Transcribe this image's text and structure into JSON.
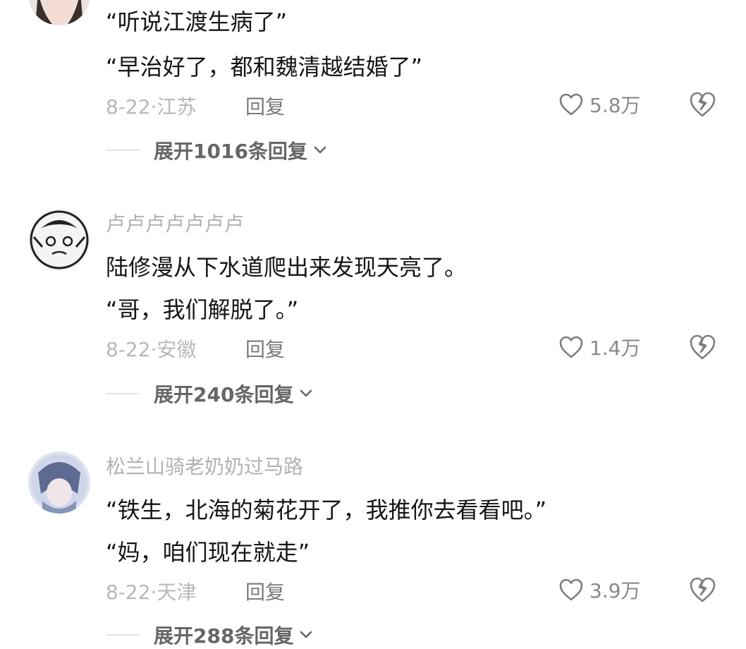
{
  "comments": [
    {
      "username": "",
      "lines": [
        "“听说江渡生病了”",
        "“早治好了，都和魏清越结婚了”"
      ],
      "date_location": "8-22·江苏",
      "reply_label": "回复",
      "likes": "5.8万",
      "expand_label": "展开1016条回复"
    },
    {
      "username": "卢卢卢卢卢卢卢",
      "lines": [
        "陆修漫从下水道爬出来发现天亮了。",
        "“哥，我们解脱了。”"
      ],
      "date_location": "8-22·安徽",
      "reply_label": "回复",
      "likes": "1.4万",
      "expand_label": "展开240条回复"
    },
    {
      "username": "松兰山骑老奶奶过马路",
      "lines": [
        "“铁生，北海的菊花开了，我推你去看看吧。”",
        "“妈，咱们现在就走”"
      ],
      "date_location": "8-22·天津",
      "reply_label": "回复",
      "likes": "3.9万",
      "expand_label": "展开288条回复"
    }
  ],
  "colors": {
    "text": "#161616",
    "muted": "#b2b2b2",
    "icon": "#7d7d7d"
  }
}
